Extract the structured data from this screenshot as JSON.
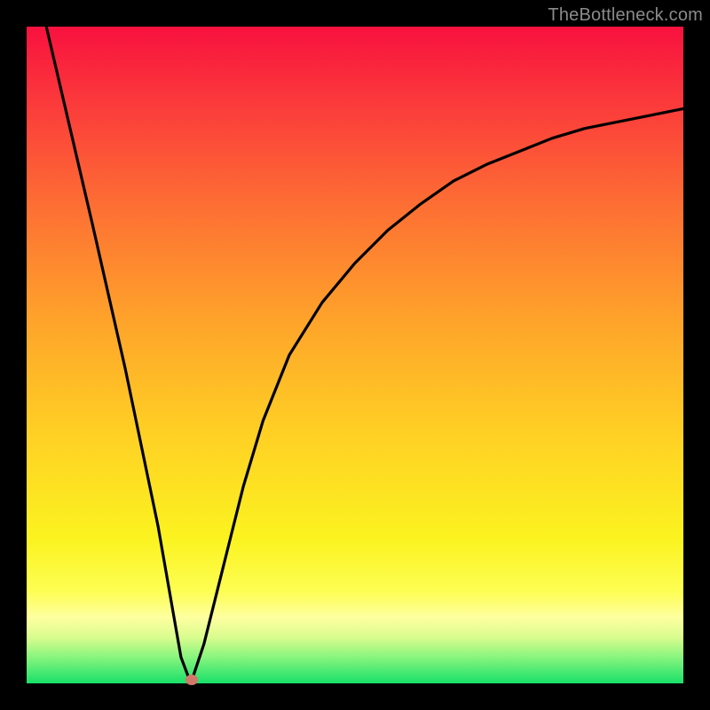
{
  "watermark": "TheBottleneck.com",
  "chart_data": {
    "type": "line",
    "title": "",
    "xlabel": "",
    "ylabel": "",
    "xlim": [
      0,
      100
    ],
    "ylim": [
      0,
      100
    ],
    "grid": false,
    "series": [
      {
        "name": "curve",
        "color": "#000000",
        "x": [
          3,
          10,
          15,
          20,
          23.5,
          25,
          27,
          30,
          33,
          36,
          40,
          45,
          50,
          55,
          60,
          65,
          70,
          75,
          80,
          85,
          90,
          95,
          100
        ],
        "values": [
          100,
          70,
          48,
          24,
          4,
          0,
          6,
          18,
          30,
          40,
          50,
          58,
          64,
          69,
          73,
          76.5,
          79,
          81,
          83,
          84.5,
          85.5,
          86.5,
          87.5
        ]
      }
    ],
    "marker": {
      "x": 25.2,
      "y": 0.5,
      "color": "#d2786b"
    },
    "background_gradient": {
      "stops": [
        {
          "pct": 0,
          "color": "#f8113f"
        },
        {
          "pct": 12,
          "color": "#fb3b3b"
        },
        {
          "pct": 28,
          "color": "#fd7133"
        },
        {
          "pct": 45,
          "color": "#fea42a"
        },
        {
          "pct": 62,
          "color": "#ffd024"
        },
        {
          "pct": 78,
          "color": "#fbf320"
        },
        {
          "pct": 86,
          "color": "#fdfe53"
        },
        {
          "pct": 90,
          "color": "#feffa0"
        },
        {
          "pct": 93,
          "color": "#d9fc8e"
        },
        {
          "pct": 96,
          "color": "#88f57e"
        },
        {
          "pct": 100,
          "color": "#18e069"
        }
      ]
    }
  }
}
